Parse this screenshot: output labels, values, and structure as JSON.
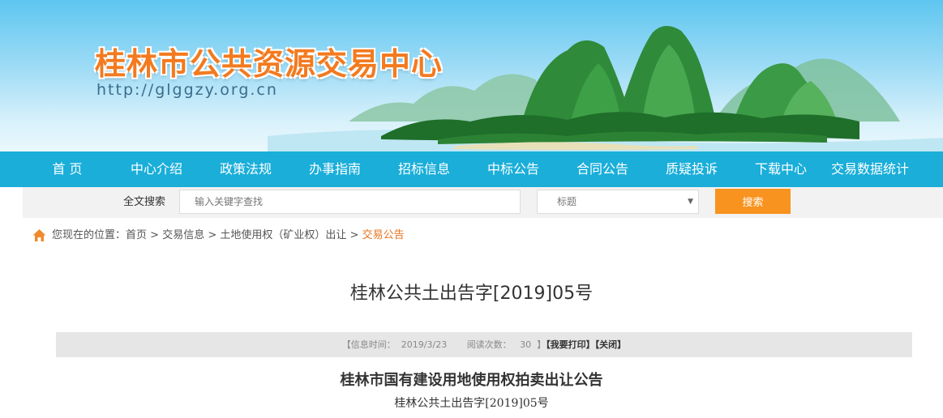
{
  "header": {
    "site_title": "桂林市公共资源交易中心",
    "site_url": "http://glggzy.org.cn"
  },
  "nav": {
    "items": [
      {
        "label": "首 页"
      },
      {
        "label": "中心介绍"
      },
      {
        "label": "政策法规"
      },
      {
        "label": "办事指南"
      },
      {
        "label": "招标信息"
      },
      {
        "label": "中标公告"
      },
      {
        "label": "合同公告"
      },
      {
        "label": "质疑投诉"
      },
      {
        "label": "下载中心"
      },
      {
        "label": "交易数据统计"
      }
    ]
  },
  "search": {
    "label": "全文搜索",
    "placeholder": "输入关键字查找",
    "select_value": "标题",
    "button_label": "搜索"
  },
  "breadcrumb": {
    "prefix": "您现在的位置：",
    "items": [
      "首页",
      "交易信息",
      "土地使用权（矿业权）出让",
      "交易公告"
    ],
    "separator": " > "
  },
  "article": {
    "title": "桂林公共土出告字[2019]05号",
    "info_time_label": "【信息时间：",
    "info_time": "2019/3/23",
    "info_reads_label": "阅读次数：",
    "info_reads": "30",
    "info_close_bracket": "】",
    "print_label": "【我要打印】",
    "close_label": "【关闭】",
    "notice_title": "桂林市国有建设用地使用权拍卖出让公告",
    "notice_subtitle": "桂林公共土出告字[2019]05号"
  },
  "colors": {
    "brand_orange": "#f37a1f",
    "nav_blue": "#1aaed9",
    "button_orange": "#f7931e",
    "breadcrumb_current": "#e8731f"
  },
  "icons": {
    "home": "home-icon",
    "dropdown": "chevron-down-icon"
  }
}
